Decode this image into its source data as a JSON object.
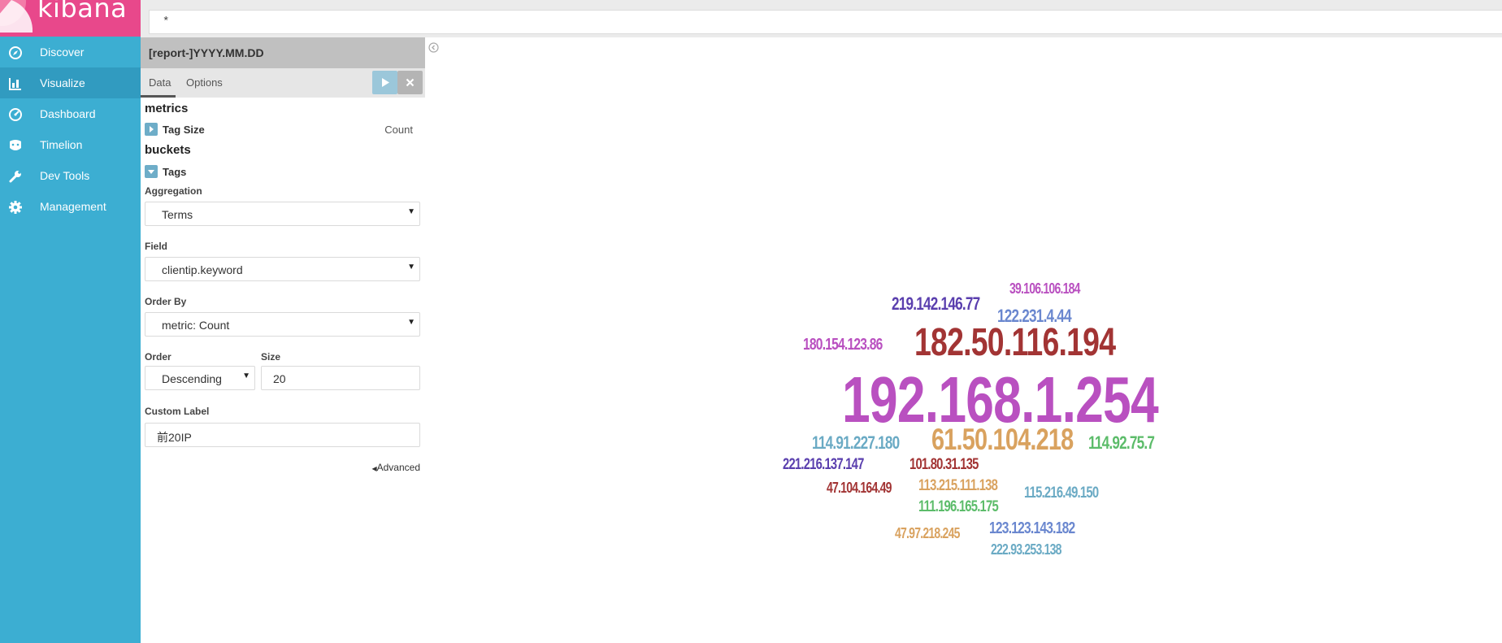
{
  "app": {
    "logo_text": "kibana"
  },
  "sidebar": {
    "items": [
      {
        "label": "Discover",
        "icon": "compass-icon"
      },
      {
        "label": "Visualize",
        "icon": "bar-chart-icon"
      },
      {
        "label": "Dashboard",
        "icon": "dashboard-gauge-icon"
      },
      {
        "label": "Timelion",
        "icon": "timelion-icon"
      },
      {
        "label": "Dev Tools",
        "icon": "wrench-icon"
      },
      {
        "label": "Management",
        "icon": "gear-icon"
      }
    ]
  },
  "query": {
    "value": "*"
  },
  "editor": {
    "index_pattern": "[report-]YYYY.MM.DD",
    "tabs": [
      {
        "label": "Data"
      },
      {
        "label": "Options"
      }
    ],
    "metrics": {
      "title": "metrics",
      "agg_label": "Tag Size",
      "agg_value": "Count"
    },
    "buckets": {
      "title": "buckets",
      "agg_label": "Tags",
      "aggregation": {
        "label": "Aggregation",
        "value": "Terms"
      },
      "field": {
        "label": "Field",
        "value": "clientip.keyword"
      },
      "order_by": {
        "label": "Order By",
        "value": "metric: Count"
      },
      "order": {
        "label": "Order",
        "value": "Descending"
      },
      "size": {
        "label": "Size",
        "value": "20"
      },
      "custom_label": {
        "label": "Custom Label",
        "value": "前20IP"
      }
    },
    "advanced_label": "Advanced"
  },
  "colors": {
    "sidebar": "#3caed2",
    "logo_bg": "#e8488b",
    "purple": "#b950c0",
    "dark_red": "#a23434",
    "indigo": "#5a3fae",
    "blue": "#6a87cf",
    "teal": "#6aaac4",
    "orange": "#d9a25f",
    "green": "#5cbc6a"
  },
  "word_cloud": [
    {
      "text": "192.168.1.254",
      "color": "#b950c0"
    },
    {
      "text": "182.50.116.194",
      "color": "#a23434"
    },
    {
      "text": "61.50.104.218",
      "color": "#d9a25f"
    },
    {
      "text": "219.142.146.77",
      "color": "#5a3fae"
    },
    {
      "text": "39.106.106.184",
      "color": "#b950c0"
    },
    {
      "text": "122.231.4.44",
      "color": "#6a87cf"
    },
    {
      "text": "180.154.123.86",
      "color": "#b950c0"
    },
    {
      "text": "114.91.227.180",
      "color": "#6aaac4"
    },
    {
      "text": "114.92.75.7",
      "color": "#5cbc6a"
    },
    {
      "text": "221.216.137.147",
      "color": "#5a3fae"
    },
    {
      "text": "101.80.31.135",
      "color": "#a23434"
    },
    {
      "text": "113.215.111.138",
      "color": "#d9a25f"
    },
    {
      "text": "47.104.164.49",
      "color": "#a23434"
    },
    {
      "text": "115.216.49.150",
      "color": "#6aaac4"
    },
    {
      "text": "111.196.165.175",
      "color": "#5cbc6a"
    },
    {
      "text": "123.123.143.182",
      "color": "#6a87cf"
    },
    {
      "text": "47.97.218.245",
      "color": "#d9a25f"
    },
    {
      "text": "222.93.253.138",
      "color": "#6aaac4"
    }
  ]
}
